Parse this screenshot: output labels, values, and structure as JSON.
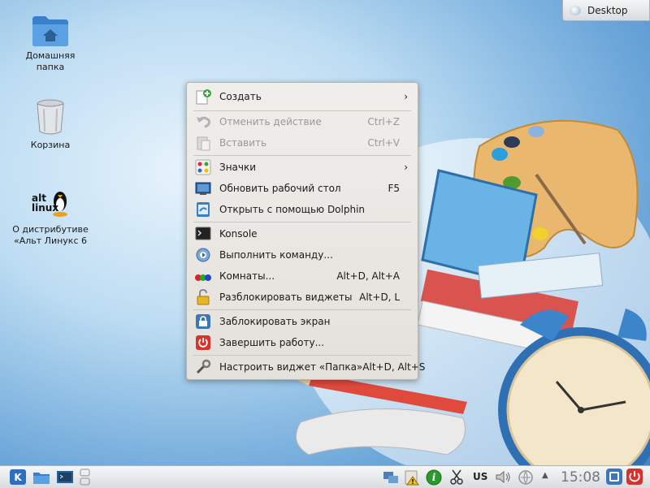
{
  "desktop_button": {
    "label": "Desktop",
    "icon": "desktop-icon"
  },
  "desktop_icons": [
    {
      "label": "Домашняя\nпапка",
      "icon": "home-folder-icon"
    },
    {
      "label": "Корзина",
      "icon": "trash-icon"
    },
    {
      "label": "О дистрибутиве\n«Альт Линукс 6",
      "icon": "alt-linux-logo-icon",
      "logo_text": "alt linux"
    }
  ],
  "context_menu": {
    "items": [
      {
        "label": "Создать",
        "shortcut": "",
        "submenu": true,
        "disabled": false,
        "icon": "create-new-icon"
      },
      {
        "label": "Отменить действие",
        "shortcut": "Ctrl+Z",
        "submenu": false,
        "disabled": true,
        "icon": "undo-icon"
      },
      {
        "label": "Вставить",
        "shortcut": "Ctrl+V",
        "submenu": false,
        "disabled": true,
        "icon": "paste-icon"
      },
      {
        "label": "Значки",
        "shortcut": "",
        "submenu": true,
        "disabled": false,
        "icon": "icons-grid-icon"
      },
      {
        "label": "Обновить рабочий стол",
        "shortcut": "F5",
        "submenu": false,
        "disabled": false,
        "icon": "refresh-desktop-icon"
      },
      {
        "label": "Открыть с помощью Dolphin",
        "shortcut": "",
        "submenu": false,
        "disabled": false,
        "icon": "dolphin-icon"
      },
      {
        "label": "Konsole",
        "shortcut": "",
        "submenu": false,
        "disabled": false,
        "icon": "terminal-icon"
      },
      {
        "label": "Выполнить команду...",
        "shortcut": "",
        "submenu": false,
        "disabled": false,
        "icon": "run-command-icon"
      },
      {
        "label": "Комнаты...",
        "shortcut": "Alt+D, Alt+A",
        "submenu": false,
        "disabled": false,
        "icon": "activities-icon"
      },
      {
        "label": "Разблокировать виджеты",
        "shortcut": "Alt+D, L",
        "submenu": false,
        "disabled": false,
        "icon": "unlock-icon"
      },
      {
        "label": "Заблокировать экран",
        "shortcut": "",
        "submenu": false,
        "disabled": false,
        "icon": "lock-screen-icon"
      },
      {
        "label": "Завершить работу...",
        "shortcut": "",
        "submenu": false,
        "disabled": false,
        "icon": "shutdown-icon"
      },
      {
        "label": "Настроить виджет «Папка»",
        "shortcut": "Alt+D, Alt+S",
        "submenu": false,
        "disabled": false,
        "icon": "configure-icon"
      }
    ]
  },
  "taskbar": {
    "language": "US",
    "clock": "15:08",
    "launchers": [
      "kde-menu-icon",
      "file-manager-icon",
      "terminal-icon",
      "desktop-pager-icon"
    ],
    "tray": [
      "network-icon",
      "updates-warning-icon",
      "info-icon",
      "scissors-icon",
      "volume-icon",
      "network-manager-icon",
      "tray-expand-icon",
      "lock-screen-icon",
      "shutdown-icon"
    ]
  },
  "colors": {
    "accent": "#3f80c4",
    "menu_bg": "#ebe8e4",
    "shutdown_red": "#d8332a"
  }
}
